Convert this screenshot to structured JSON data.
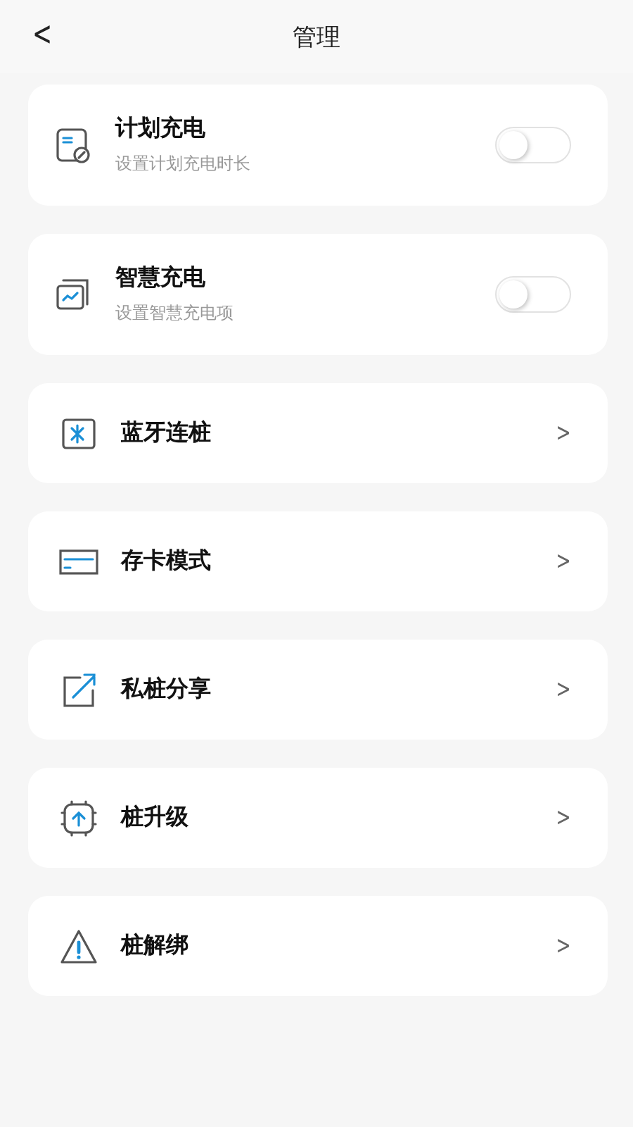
{
  "header": {
    "back": "<",
    "title": "管理"
  },
  "items": [
    {
      "kind": "toggle",
      "title": "计划充电",
      "subtitle": "设置计划充电时长",
      "on": false
    },
    {
      "kind": "toggle",
      "title": "智慧充电",
      "subtitle": "设置智慧充电项",
      "on": false
    },
    {
      "kind": "link",
      "title": "蓝牙连桩",
      "chevron": ">"
    },
    {
      "kind": "link",
      "title": "存卡模式",
      "chevron": ">"
    },
    {
      "kind": "link",
      "title": "私桩分享",
      "chevron": ">"
    },
    {
      "kind": "link",
      "title": "桩升级",
      "chevron": ">"
    },
    {
      "kind": "link",
      "title": "桩解绑",
      "chevron": ">"
    }
  ]
}
